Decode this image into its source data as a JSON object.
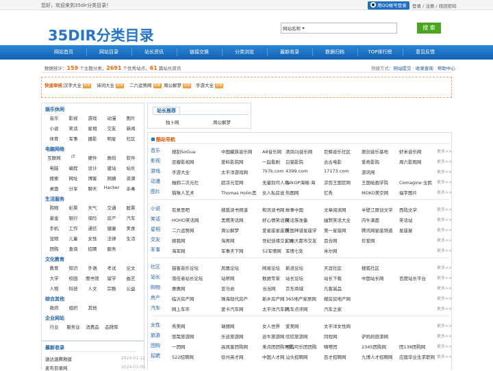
{
  "topbar": {
    "welcome": "您好，欢迎来到35dir分类目录！",
    "qq_login": "用QQ帐号登录",
    "login": "登录",
    "register": "注册",
    "find_pwd": "找回密码"
  },
  "logo": {
    "text": "35DIR分类目录"
  },
  "search": {
    "select_label": "网站名称",
    "placeholder": "",
    "button": "搜 索"
  },
  "nav": [
    "网站首页",
    "网站目录",
    "站长资讯",
    "链接交换",
    "分类浏览",
    "最新收录",
    "数据归档",
    "TOP排行榜",
    "意见反馈"
  ],
  "stats": {
    "prefix": "数据统计：",
    "topics": "159",
    "topics_text": "个主题分类，",
    "sites": "2691",
    "sites_text": "个优秀站点，",
    "articles": "61",
    "articles_text": "篇站长资讯",
    "quick_label": "快捷方式：",
    "quick": [
      "网站提交",
      "收录查询",
      "帮助中心"
    ]
  },
  "audit": {
    "label": "快速审核：",
    "items": [
      {
        "name": "汉字大全",
        "tag": "快审"
      },
      {
        "name": "诗词大全",
        "tag": "快审"
      },
      {
        "name": "二六运势网",
        "tag": "快审"
      },
      {
        "name": "周公解梦",
        "tag": "快审"
      },
      {
        "name": "手游大全",
        "tag": "快审"
      }
    ]
  },
  "sidebar": {
    "categories": [
      {
        "title": "娱乐休闲",
        "items": [
          "音乐",
          "影视",
          "游戏",
          "动漫",
          "图片",
          "小说",
          "笑话",
          "星相",
          "交友",
          "新闻",
          "体育",
          "军事",
          "摄影",
          "明星",
          "社区"
        ]
      },
      {
        "title": "电脑网络",
        "items": [
          "互联网",
          "IT",
          "硬件",
          "数码",
          "软件",
          "电脑",
          "编程",
          "设计",
          "建站",
          "站长",
          "搜索",
          "网址",
          "博客",
          "网摘",
          "资源",
          "桌面",
          "分享",
          "聊天",
          "Hacker",
          "杀毒"
        ]
      },
      {
        "title": "生活服务",
        "items": [
          "购物",
          "彩票",
          "天气",
          "交通",
          "股票",
          "基金",
          "银行",
          "保险",
          "房产",
          "汽车",
          "手机",
          "工作",
          "通信",
          "健康",
          "美食",
          "宠物",
          "儿童",
          "女性",
          "法律",
          "生活",
          "团购",
          "查询",
          "招聘",
          "服务"
        ]
      },
      {
        "title": "文化教育",
        "items": [
          "教育",
          "知识",
          "外语",
          "考试",
          "论文",
          "大学",
          "校园",
          "图书馆",
          "留学",
          "曲艺",
          "人物",
          "科技",
          "人文",
          "宗教",
          "公益"
        ]
      },
      {
        "title": "综合其他",
        "items": [
          "政府",
          "组织",
          "其他"
        ]
      },
      {
        "title": "企业网站",
        "items": [
          "行业",
          "服务业",
          "消费品",
          "品牌库"
        ]
      }
    ]
  },
  "recent": {
    "title": "最新收录",
    "items": [
      {
        "name": "速达速腾救援",
        "date": "2024-01-12"
      },
      {
        "name": "麦布目录网",
        "date": "2024-01-09"
      }
    ]
  },
  "recommend": {
    "title": "站长推荐",
    "items": [
      "独卜网",
      "周公解梦"
    ]
  },
  "cool": {
    "title": "酷站导航",
    "more": "更多>>",
    "groups": [
      [
        {
          "c": "音乐",
          "s": [
            "搜刮SoGua",
            "中国藏族音乐网",
            "A8音乐网",
            "清风DJ音乐网",
            "巨鲸音乐社区",
            "原创音乐基地",
            "虾米音乐网"
          ]
        },
        {
          "c": "影视",
          "s": [
            "豆瓣影视网",
            "爱料影院网",
            "一起看剧",
            "白猫影院",
            "古古电影",
            "爱奇影院",
            "周六影观网"
          ]
        },
        {
          "c": "游戏",
          "s": [
            "手游大全",
            "太平洋游戏网",
            "7k7k.com",
            "4399.com",
            "17173.com",
            "游讯网",
            ""
          ]
        },
        {
          "c": "动漫",
          "s": [
            "柚鸥二次元社",
            "超凉元官网",
            "无量别司人站",
            "TalkOP海贼-海",
            "凉剪王国官网",
            "王国绘画学院",
            "Comagine 全民"
          ]
        },
        {
          "c": "图片",
          "s": [
            "猫咪人艺术",
            "Thomas Holm黑",
            "女人私房说",
            "热图网",
            "忆秀",
            "MOKO美空网",
            "福字图片"
          ]
        }
      ],
      [
        {
          "c": "小说",
          "s": [
            "有意思吧",
            "搜狐读书频道",
            "和讯读书网",
            "故事中国",
            "文章阅读网",
            "半壁江原创文学",
            "西陆文学"
          ]
        },
        {
          "c": "笑话",
          "s": [
            "HOHO笑话网",
            "黑鹰笑话网",
            "好心情笑话网",
            "笑话族准备",
            "幽默笑话大全",
            "内牛满面",
            "笑话站"
          ]
        },
        {
          "c": "星相",
          "s": [
            "二六运势网",
            "周公解梦",
            "爱星座星座网",
            "美国神谱星座学",
            "第一星座网",
            "腾讯网星座频道",
            "星座屋"
          ]
        },
        {
          "c": "交友",
          "s": [
            "嫁我网",
            "淘男网",
            "世纪佳缘交友网",
            "广州大都市交友",
            "百合网",
            "珍爱网",
            ""
          ]
        },
        {
          "c": "军事",
          "s": [
            "海军网",
            "军事天下网",
            "52军情网",
            "军情七处",
            "米尔网",
            "",
            ""
          ]
        }
      ],
      [
        {
          "c": "社区",
          "s": [
            "猫客音乐论坛",
            "凤凰论坛",
            "网易论坛",
            "新浪论坛",
            "天涯社区",
            "搜狐社区",
            ""
          ]
        },
        {
          "c": "站长",
          "s": [
            "落伍者站长论坛",
            "站帮网",
            "数据专家",
            "站长论坛",
            "站长下载",
            "中国站长网",
            "百度站长平台"
          ]
        },
        {
          "c": "购物",
          "s": [
            "惠惠网",
            "亚马逊",
            "当当网",
            "京东商城",
            "凡客诚品",
            "",
            ""
          ]
        },
        {
          "c": "房产",
          "s": [
            "临沂房产网",
            "珠海现代房产",
            "新乡房产网",
            "365地产家居网",
            "搜房房地产网",
            "",
            ""
          ]
        },
        {
          "c": "汽车",
          "s": [
            "网上车市",
            "爱卡汽车网",
            "太平洋汽车网",
            "汽车点评网",
            "汽车之家",
            "",
            ""
          ]
        }
      ],
      [
        {
          "c": "女性",
          "s": [
            "秀美网",
            "瑞丽网",
            "女人世界",
            "爱美网",
            "太平洋女性网",
            "",
            ""
          ]
        },
        {
          "c": "旅游",
          "s": [
            "悠哉旅游网",
            "乐途旅游网",
            "途牛旅游网",
            "欣欣旅游网",
            "同程网",
            "驴妈妈旅游网",
            ""
          ]
        },
        {
          "c": "团购",
          "s": [
            "一团网",
            "高凤客团购网",
            "来点团团购导航",
            "可购可乐团团购",
            "嘀嗒团",
            "2345团购网",
            "团138团购网"
          ]
        },
        {
          "c": "招聘",
          "s": [
            "522招聘网",
            "徐州英才网",
            "中国人才网",
            "汕头招聘网",
            "百才招聘网",
            "九博人才招聘网",
            "应届毕业生求职网"
          ]
        }
      ]
    ]
  }
}
